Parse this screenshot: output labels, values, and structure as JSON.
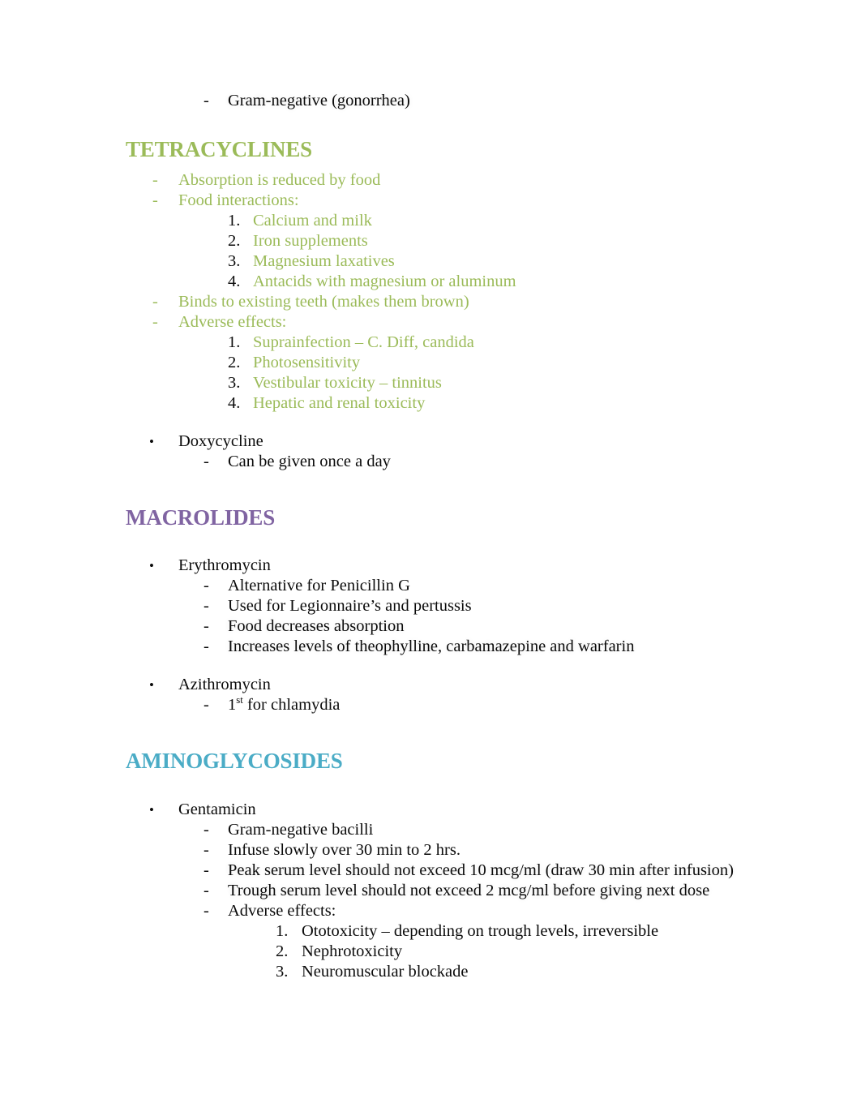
{
  "document": {
    "intro_item": {
      "marker": "-",
      "text": "Gram-negative (gonorrhea)"
    },
    "sections": [
      {
        "heading": "TETRACYCLINES",
        "heading_color": "#9BBB59",
        "body_color": "#9BBB59",
        "items": [
          {
            "marker": "-",
            "text": "Absorption is reduced by food"
          },
          {
            "marker": "-",
            "text": "Food interactions:"
          },
          {
            "marker": "1.",
            "text": "Calcium and milk"
          },
          {
            "marker": "2.",
            "text": "Iron supplements"
          },
          {
            "marker": "3.",
            "text": "Magnesium laxatives"
          },
          {
            "marker": "4.",
            "text": "Antacids with magnesium or aluminum"
          },
          {
            "marker": "-",
            "text": "Binds to existing teeth (makes them brown)"
          },
          {
            "marker": "-",
            "text": "Adverse effects:"
          },
          {
            "marker": "1.",
            "text": "Suprainfection – C. Diff, candida"
          },
          {
            "marker": "2.",
            "text": "Photosensitivity"
          },
          {
            "marker": "3.",
            "text": "Vestibular toxicity – tinnitus"
          },
          {
            "marker": "4.",
            "text": "Hepatic and renal toxicity"
          }
        ],
        "drugs": [
          {
            "bullet": "•",
            "name": "Doxycycline",
            "details": [
              {
                "marker": "-",
                "text": "Can be given once a day"
              }
            ]
          }
        ]
      },
      {
        "heading": "MACROLIDES",
        "heading_color": "#8064A2",
        "body_color": "#0b0b0b",
        "items": [],
        "drugs": [
          {
            "bullet": "•",
            "name": "Erythromycin",
            "details": [
              {
                "marker": "-",
                "text": "Alternative for Penicillin G"
              },
              {
                "marker": "-",
                "text": "Used for Legionnaire’s and pertussis"
              },
              {
                "marker": "-",
                "text": "Food decreases absorption"
              },
              {
                "marker": "-",
                "text": "Increases levels of theophylline, carbamazepine and warfarin"
              }
            ]
          },
          {
            "bullet": "•",
            "name": "Azithromycin",
            "details": [
              {
                "marker": "-",
                "text_prefix": "1",
                "text_sup": "st",
                "text_suffix": " for chlamydia"
              }
            ]
          }
        ]
      },
      {
        "heading": "AMINOGLYCOSIDES",
        "heading_color": "#4BACC6",
        "body_color": "#0b0b0b",
        "items": [],
        "drugs": [
          {
            "bullet": "•",
            "name": "Gentamicin",
            "details": [
              {
                "marker": "-",
                "text": "Gram-negative bacilli"
              },
              {
                "marker": "-",
                "text": "Infuse slowly over 30 min to 2 hrs."
              },
              {
                "marker": "-",
                "text": "Peak serum level should not exceed 10 mcg/ml (draw 30 min after infusion)"
              },
              {
                "marker": "-",
                "text": "Trough serum level should not exceed 2 mcg/ml before giving next dose"
              },
              {
                "marker": "-",
                "text": "Adverse effects:"
              }
            ],
            "sub_numbered": [
              {
                "marker": "1.",
                "text": "Ototoxicity – depending on trough levels, irreversible"
              },
              {
                "marker": "2.",
                "text": "Nephrotoxicity"
              },
              {
                "marker": "3.",
                "text": "Neuromuscular blockade"
              }
            ]
          }
        ]
      }
    ]
  }
}
